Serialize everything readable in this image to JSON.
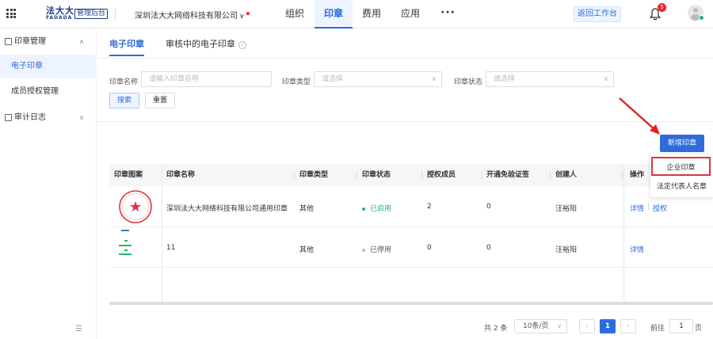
{
  "header": {
    "logo_text": "法大大",
    "logo_sub": "FADADA",
    "admin_badge": "管理后台",
    "company": "深圳法大大网络科技有限公司",
    "nav": [
      "组织",
      "印章",
      "费用",
      "应用"
    ],
    "active_nav": "印章",
    "more": "···",
    "back_button": "返回工作台",
    "notification_count": "5"
  },
  "sidebar": {
    "group_seal": "印章管理",
    "items": [
      "电子印章",
      "成员授权管理"
    ],
    "group_audit": "审计日志"
  },
  "tabs": {
    "e_seal": "电子印章",
    "pending": "审核中的电子印章",
    "help": "?"
  },
  "filters": {
    "name_label": "印章名称",
    "name_placeholder": "请输入印章名称",
    "type_label": "印章类型",
    "type_placeholder": "请选择",
    "status_label": "印章状态",
    "status_placeholder": "请选择",
    "search": "搜索",
    "reset": "重置"
  },
  "actions": {
    "new_seal": "新增印章",
    "menu": [
      "企业印章",
      "法定代表人名章"
    ]
  },
  "table": {
    "columns": [
      "印章图案",
      "印章名称",
      "印章类型",
      "印章状态",
      "授权成员",
      "开通免验证签",
      "创建人",
      "操作"
    ],
    "rows": [
      {
        "name": "深圳法大大网络科技有限公司通用印章",
        "type": "其他",
        "status": "已启用",
        "members": "2",
        "exempt": "0",
        "creator": "汪裕阳",
        "ops": [
          "详情",
          "授权"
        ]
      },
      {
        "name": "11",
        "type": "其他",
        "status": "已停用",
        "members": "0",
        "exempt": "0",
        "creator": "汪裕阳",
        "ops": [
          "详情"
        ]
      }
    ]
  },
  "pagination": {
    "total": "共 2 条",
    "page_size": "10条/页",
    "prev": "‹",
    "current": "1",
    "next": "›",
    "goto_label": "前往",
    "goto_value": "1",
    "page_unit": "页"
  },
  "colors": {
    "accent": "#2f6bdb",
    "enabled": "#22b573",
    "disabled": "#bbbbbb",
    "highlight": "#d9363e"
  }
}
